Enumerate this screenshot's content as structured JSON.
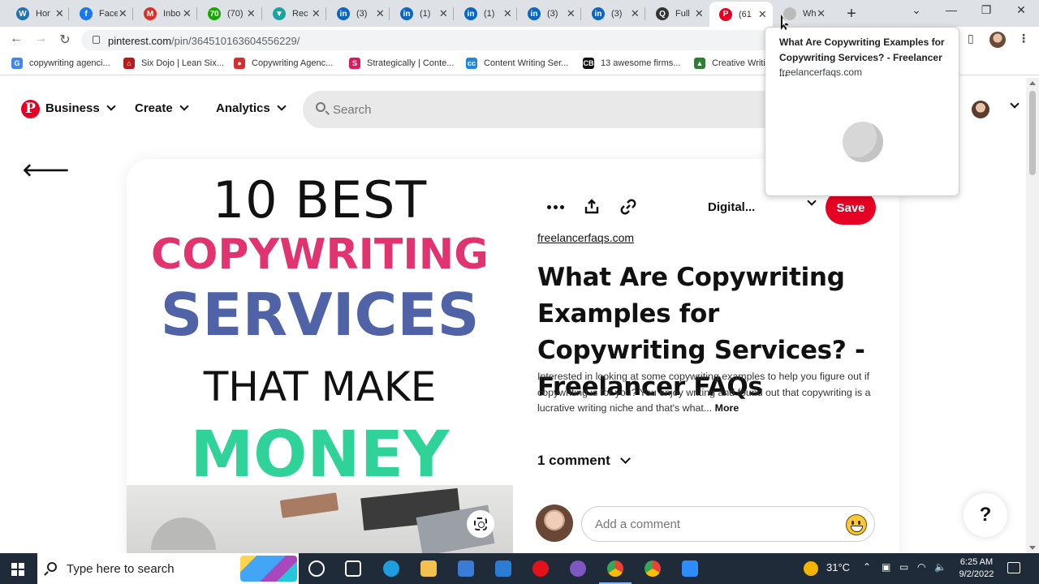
{
  "browser": {
    "tabs": [
      {
        "title": "Hor",
        "icon": "wordpress-icon",
        "color": "#2271b1",
        "glyph": "W"
      },
      {
        "title": "Face",
        "icon": "facebook-icon",
        "color": "#1877f2",
        "glyph": "f"
      },
      {
        "title": "Inbo",
        "icon": "gmail-icon",
        "color": "#d93025",
        "glyph": "M"
      },
      {
        "title": "(70)",
        "icon": "upwork-icon",
        "color": "#14a800",
        "glyph": "70"
      },
      {
        "title": "Rec",
        "icon": "feather-icon",
        "color": "#19a3a3",
        "glyph": "▼"
      },
      {
        "title": "(3)",
        "icon": "linkedin-icon",
        "color": "#0a66c2",
        "glyph": "in"
      },
      {
        "title": "(1)",
        "icon": "linkedin-icon",
        "color": "#0a66c2",
        "glyph": "in"
      },
      {
        "title": "(1)",
        "icon": "linkedin-icon",
        "color": "#0a66c2",
        "glyph": "in"
      },
      {
        "title": "(3)",
        "icon": "linkedin-icon",
        "color": "#0a66c2",
        "glyph": "in"
      },
      {
        "title": "(3)",
        "icon": "linkedin-icon",
        "color": "#0a66c2",
        "glyph": "in"
      },
      {
        "title": "Full",
        "icon": "search-magnifier-icon",
        "color": "#333333",
        "glyph": "Q"
      },
      {
        "title": "(61",
        "icon": "pinterest-icon",
        "color": "#e60023",
        "glyph": "P",
        "active": true
      },
      {
        "title": "Wh",
        "icon": "loading-icon",
        "color": "#bbbbbb",
        "glyph": ""
      }
    ],
    "url_host": "pinterest.com",
    "url_path": "/pin/364510163604556229/",
    "bookmarks": [
      {
        "label": "copywriting agenci...",
        "icon": "google-icon",
        "color": "#4285f4",
        "glyph": "G"
      },
      {
        "label": "Six Dojo | Lean Six...",
        "icon": "dojo-icon",
        "color": "#b71c1c",
        "glyph": "⌂"
      },
      {
        "label": "Copywriting Agenc...",
        "icon": "agency-icon",
        "color": "#d32f2f",
        "glyph": "●"
      },
      {
        "label": "Strategically | Conte...",
        "icon": "strategically-icon",
        "color": "#d81b60",
        "glyph": "S"
      },
      {
        "label": "Content Writing Ser...",
        "icon": "content-icon",
        "color": "#1e88e5",
        "glyph": "cc"
      },
      {
        "label": "13 awesome firms...",
        "icon": "cb-icon",
        "color": "#111111",
        "glyph": "CB"
      },
      {
        "label": "Creative Writi",
        "icon": "creative-icon",
        "color": "#2e7d32",
        "glyph": "▲"
      }
    ],
    "hovercard": {
      "title": "What Are Copywriting Examples for Copywriting Services? - Freelancer ...",
      "domain": "freelancerfaqs.com"
    }
  },
  "header": {
    "logo": "P",
    "nav": [
      "Business",
      "Create",
      "Analytics"
    ],
    "search_placeholder": "Search"
  },
  "pin": {
    "image_lines": [
      "10 BEST",
      "COPYWRITING",
      "SERVICES",
      "THAT MAKE",
      "MONEY"
    ],
    "board": "Digital...",
    "save_label": "Save",
    "source": "freelancerfaqs.com",
    "title": "What Are Copywriting Examples for Copywriting Services? - Freelancer FAQs",
    "description": "Interested in looking at some copywriting examples to help you figure out if copywriting is for you? You enjoy writing and found out that copywriting is a lucrative writing niche and that's what...",
    "more_label": "More",
    "comments_label": "1 comment",
    "comment_placeholder": "Add a comment",
    "help_label": "?"
  },
  "taskbar": {
    "search_placeholder": "Type here to search",
    "apps": [
      {
        "name": "cortana-icon",
        "color": "#1f2b38"
      },
      {
        "name": "task-view-icon",
        "color": "#1f2b38"
      },
      {
        "name": "edge-icon",
        "color": "#1e9ede"
      },
      {
        "name": "file-explorer-icon",
        "color": "#f2c14e"
      },
      {
        "name": "store-icon",
        "color": "#3a7bd5"
      },
      {
        "name": "mail-icon",
        "color": "#2b7cd3"
      },
      {
        "name": "opera-icon",
        "color": "#e3131b"
      },
      {
        "name": "app-swirl-icon",
        "color": "#7e57c2"
      },
      {
        "name": "chrome-icon",
        "color": "#4caf50",
        "active": true
      },
      {
        "name": "chrome-profile-icon",
        "color": "#4caf50"
      },
      {
        "name": "zoom-icon",
        "color": "#2d8cff"
      }
    ],
    "temperature": "31°C",
    "time": "6:25 AM",
    "date": "9/2/2022"
  }
}
